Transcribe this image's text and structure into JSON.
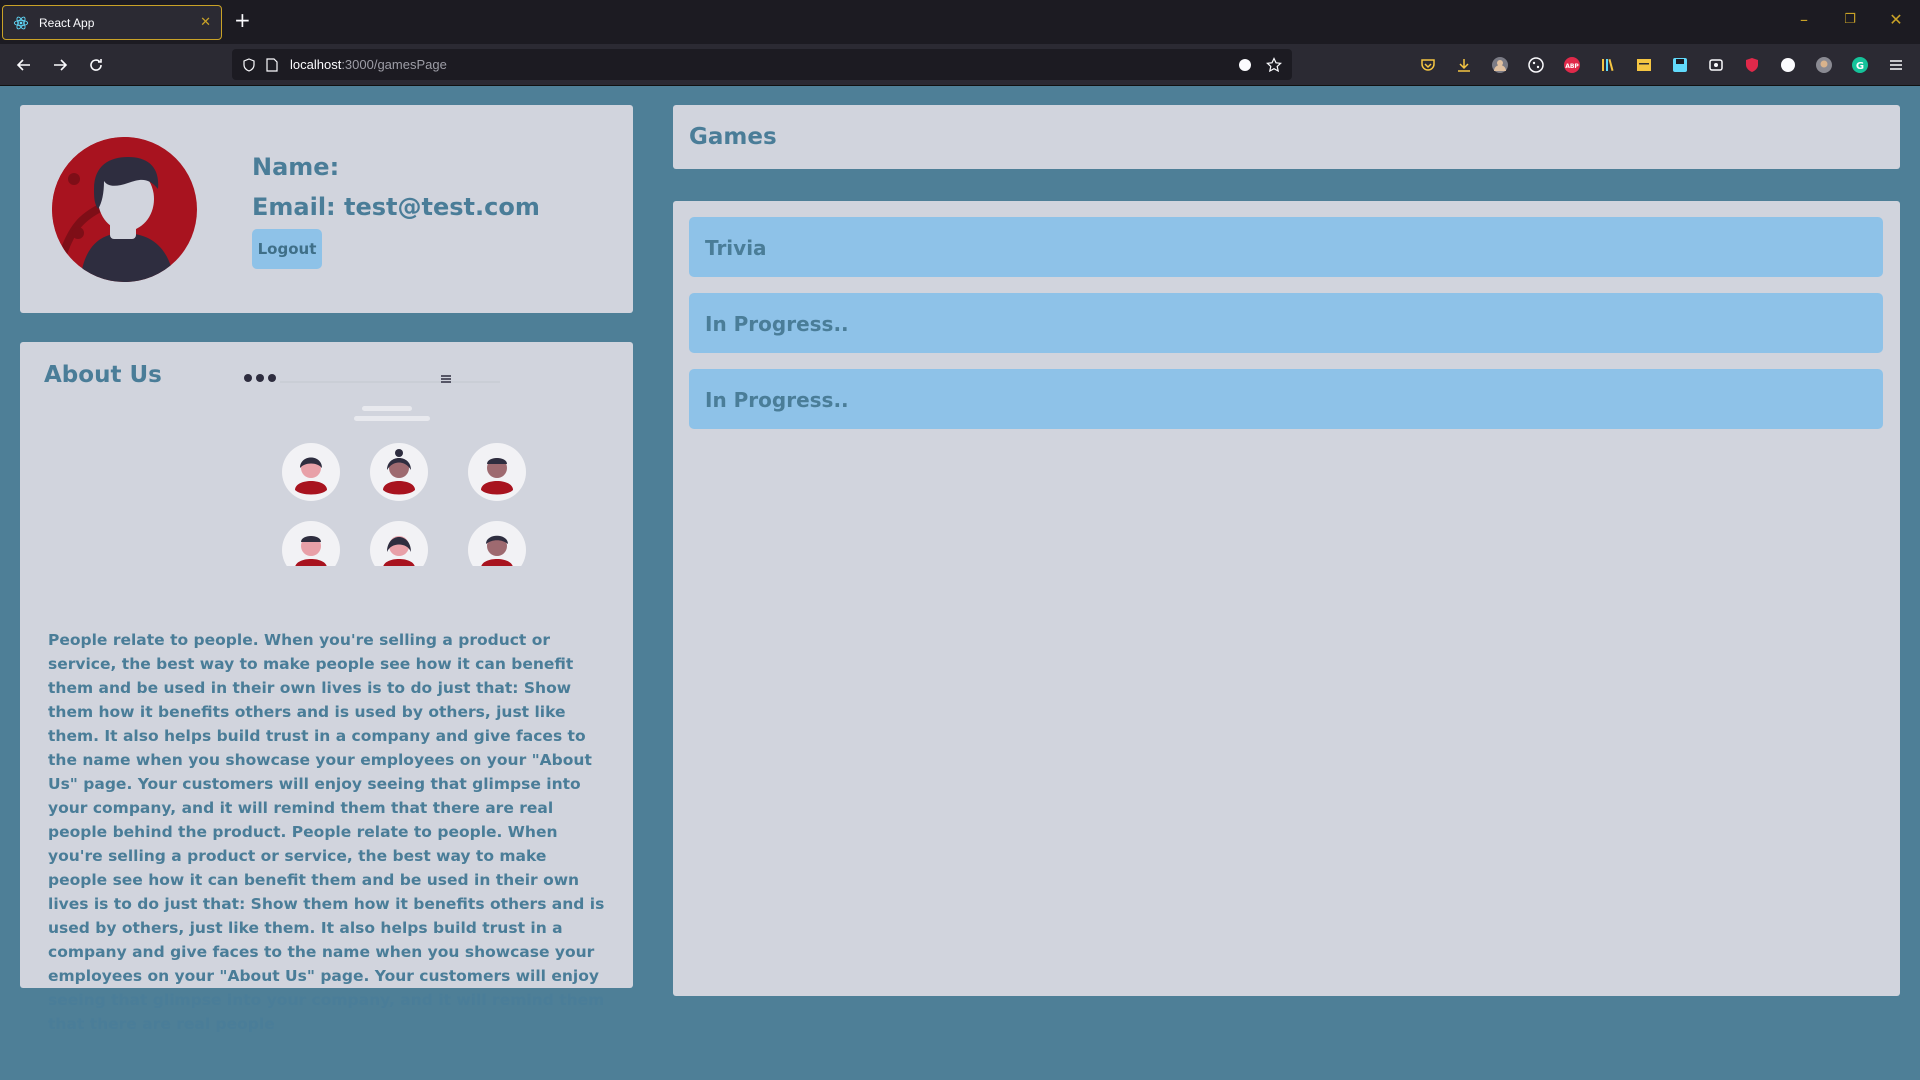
{
  "browser": {
    "tab_title": "React App",
    "tab_close": "✕",
    "new_tab": "+",
    "url_host": "localhost",
    "url_path": ":3000/gamesPage",
    "window_controls": {
      "minimize": "–",
      "restore": "❐",
      "close": "✕"
    }
  },
  "profile": {
    "name_label": "Name:",
    "email_label": "Email: test@test.com",
    "logout_label": "Logout"
  },
  "about": {
    "title": "About Us",
    "text": "People relate to people. When you're selling a product or service, the best way to make people see how it can benefit them and be used in their own lives is to do just that: Show them how it benefits others and is used by others, just like them. It also helps build trust in a company and give faces to the name when you showcase your employees on your \"About Us\" page. Your customers will enjoy seeing that glimpse into your company, and it will remind them that there are real people behind the product. People relate to people. When you're selling a product or service, the best way to make people see how it can benefit them and be used in their own lives is to do just that: Show them how it benefits others and is used by others, just like them. It also helps build trust in a company and give faces to the name when you showcase your employees on your \"About Us\" page. Your customers will enjoy seeing that glimpse into your company, and it will remind them that there are real people"
  },
  "games": {
    "title": "Games",
    "items": [
      {
        "label": "Trivia"
      },
      {
        "label": "In Progress.."
      },
      {
        "label": "In Progress.."
      }
    ]
  },
  "colors": {
    "page_bg": "#4e7f97",
    "card_bg": "#d1d4dd",
    "item_bg": "#8ec2e8",
    "text": "#4a7d98",
    "avatar_red": "#a8131f"
  }
}
